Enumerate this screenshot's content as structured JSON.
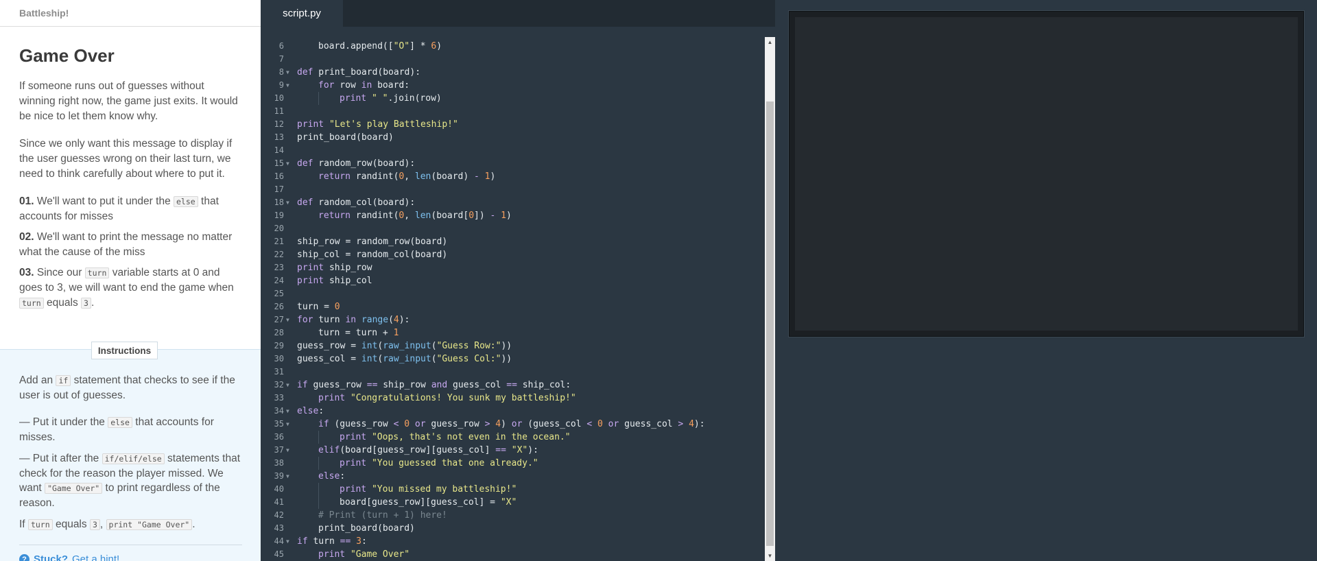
{
  "course": {
    "title": "Battleship!"
  },
  "lesson": {
    "title": "Game Over",
    "para1": "If someone runs out of guesses without winning right now, the game just exits. It would be nice to let them know why.",
    "para2": "Since we only want this message to display if the user guesses wrong on their last turn, we need to think carefully about where to put it.",
    "steps": [
      {
        "num": "01.",
        "pre": "We'll want to put it under the",
        "code": "else",
        "post": "that accounts for misses"
      },
      {
        "num": "02.",
        "text": "We'll want to print the message no matter what the cause of the miss"
      },
      {
        "num": "03.",
        "pre": "Since our",
        "code": "turn",
        "mid": "variable starts at 0 and goes to 3, we will want to end the game when",
        "code2": "turn",
        "mid2": "equals",
        "code3": "3",
        "post": "."
      }
    ]
  },
  "instructions": {
    "tab_label": "Instructions",
    "p1_pre": "Add an",
    "p1_code": "if",
    "p1_post": "statement that checks to see if the user is out of guesses.",
    "p2_pre": "— Put it under the",
    "p2_code": "else",
    "p2_post": "that accounts for misses.",
    "p3_pre": "— Put it after the",
    "p3_code": "if/elif/else",
    "p3_mid": "statements that check for the reason the player missed. We want",
    "p3_code2": "\"Game Over\"",
    "p3_post": "to print regardless of the reason.",
    "p4_pre": "If",
    "p4_code": "turn",
    "p4_mid": "equals",
    "p4_code2": "3",
    "p4_sep": ",",
    "p4_code3": "print \"Game Over\"",
    "p4_post": ".",
    "hint_stuck": "Stuck?",
    "hint_link": "Get a hint!"
  },
  "editor": {
    "tab": "script.py",
    "lines": [
      {
        "n": "6",
        "indent": 1,
        "fold": false,
        "tokens": [
          [
            "board.append([",
            ""
          ],
          [
            "\"O\"",
            "st"
          ],
          [
            "] * ",
            ""
          ],
          [
            "6",
            "nm"
          ],
          [
            ")",
            ""
          ]
        ]
      },
      {
        "n": "7",
        "indent": 0,
        "fold": false,
        "tokens": []
      },
      {
        "n": "8",
        "indent": 0,
        "fold": true,
        "tokens": [
          [
            "def",
            "kw"
          ],
          [
            " print_board(board):",
            ""
          ]
        ]
      },
      {
        "n": "9",
        "indent": 1,
        "fold": true,
        "tokens": [
          [
            "for",
            "kw"
          ],
          [
            " row ",
            ""
          ],
          [
            "in",
            "kw"
          ],
          [
            " board:",
            ""
          ]
        ]
      },
      {
        "n": "10",
        "indent": 2,
        "fold": false,
        "tokens": [
          [
            "print",
            "kw"
          ],
          [
            " ",
            ""
          ],
          [
            "\" \"",
            "st"
          ],
          [
            ".join(row)",
            ""
          ]
        ]
      },
      {
        "n": "11",
        "indent": 0,
        "fold": false,
        "tokens": []
      },
      {
        "n": "12",
        "indent": 0,
        "fold": false,
        "tokens": [
          [
            "print",
            "kw"
          ],
          [
            " ",
            ""
          ],
          [
            "\"Let's play Battleship!\"",
            "st"
          ]
        ]
      },
      {
        "n": "13",
        "indent": 0,
        "fold": false,
        "tokens": [
          [
            "print_board(board)",
            ""
          ]
        ]
      },
      {
        "n": "14",
        "indent": 0,
        "fold": false,
        "tokens": []
      },
      {
        "n": "15",
        "indent": 0,
        "fold": true,
        "tokens": [
          [
            "def",
            "kw"
          ],
          [
            " random_row(board):",
            ""
          ]
        ]
      },
      {
        "n": "16",
        "indent": 1,
        "fold": false,
        "tokens": [
          [
            "return",
            "kw"
          ],
          [
            " randint(",
            ""
          ],
          [
            "0",
            "nm"
          ],
          [
            ", ",
            ""
          ],
          [
            "len",
            "bi"
          ],
          [
            "(board) ",
            ""
          ],
          [
            "-",
            "kw"
          ],
          [
            " ",
            ""
          ],
          [
            "1",
            "nm"
          ],
          [
            ")",
            ""
          ]
        ]
      },
      {
        "n": "17",
        "indent": 0,
        "fold": false,
        "tokens": []
      },
      {
        "n": "18",
        "indent": 0,
        "fold": true,
        "tokens": [
          [
            "def",
            "kw"
          ],
          [
            " random_col(board):",
            ""
          ]
        ]
      },
      {
        "n": "19",
        "indent": 1,
        "fold": false,
        "tokens": [
          [
            "return",
            "kw"
          ],
          [
            " randint(",
            ""
          ],
          [
            "0",
            "nm"
          ],
          [
            ", ",
            ""
          ],
          [
            "len",
            "bi"
          ],
          [
            "(board[",
            ""
          ],
          [
            "0",
            "nm"
          ],
          [
            "]) ",
            ""
          ],
          [
            "-",
            "kw"
          ],
          [
            " ",
            ""
          ],
          [
            "1",
            "nm"
          ],
          [
            ")",
            ""
          ]
        ]
      },
      {
        "n": "20",
        "indent": 0,
        "fold": false,
        "tokens": []
      },
      {
        "n": "21",
        "indent": 0,
        "fold": false,
        "tokens": [
          [
            "ship_row = random_row(board)",
            ""
          ]
        ]
      },
      {
        "n": "22",
        "indent": 0,
        "fold": false,
        "tokens": [
          [
            "ship_col = random_col(board)",
            ""
          ]
        ]
      },
      {
        "n": "23",
        "indent": 0,
        "fold": false,
        "tokens": [
          [
            "print",
            "kw"
          ],
          [
            " ship_row",
            ""
          ]
        ]
      },
      {
        "n": "24",
        "indent": 0,
        "fold": false,
        "tokens": [
          [
            "print",
            "kw"
          ],
          [
            " ship_col",
            ""
          ]
        ]
      },
      {
        "n": "25",
        "indent": 0,
        "fold": false,
        "tokens": []
      },
      {
        "n": "26",
        "indent": 0,
        "fold": false,
        "tokens": [
          [
            "turn = ",
            ""
          ],
          [
            "0",
            "nm"
          ]
        ]
      },
      {
        "n": "27",
        "indent": 0,
        "fold": true,
        "tokens": [
          [
            "for",
            "kw"
          ],
          [
            " turn ",
            ""
          ],
          [
            "in",
            "kw"
          ],
          [
            " ",
            ""
          ],
          [
            "range",
            "bi"
          ],
          [
            "(",
            ""
          ],
          [
            "4",
            "nm"
          ],
          [
            "):",
            ""
          ]
        ]
      },
      {
        "n": "28",
        "indent": 1,
        "fold": false,
        "tokens": [
          [
            "turn = turn + ",
            ""
          ],
          [
            "1",
            "nm"
          ]
        ]
      },
      {
        "n": "29",
        "indent": 0,
        "fold": false,
        "tokens": [
          [
            "guess_row = ",
            ""
          ],
          [
            "int",
            "bi"
          ],
          [
            "(",
            ""
          ],
          [
            "raw_input",
            "bi"
          ],
          [
            "(",
            ""
          ],
          [
            "\"Guess Row:\"",
            "st"
          ],
          [
            "))",
            ""
          ]
        ]
      },
      {
        "n": "30",
        "indent": 0,
        "fold": false,
        "tokens": [
          [
            "guess_col = ",
            ""
          ],
          [
            "int",
            "bi"
          ],
          [
            "(",
            ""
          ],
          [
            "raw_input",
            "bi"
          ],
          [
            "(",
            ""
          ],
          [
            "\"Guess Col:\"",
            "st"
          ],
          [
            "))",
            ""
          ]
        ]
      },
      {
        "n": "31",
        "indent": 0,
        "fold": false,
        "tokens": []
      },
      {
        "n": "32",
        "indent": 0,
        "fold": true,
        "tokens": [
          [
            "if",
            "kw"
          ],
          [
            " guess_row ",
            ""
          ],
          [
            "==",
            "kw"
          ],
          [
            " ship_row ",
            ""
          ],
          [
            "and",
            "kw"
          ],
          [
            " guess_col ",
            ""
          ],
          [
            "==",
            "kw"
          ],
          [
            " ship_col:",
            ""
          ]
        ]
      },
      {
        "n": "33",
        "indent": 1,
        "fold": false,
        "tokens": [
          [
            "print",
            "kw"
          ],
          [
            " ",
            ""
          ],
          [
            "\"Congratulations! You sunk my battleship!\"",
            "st"
          ]
        ]
      },
      {
        "n": "34",
        "indent": 0,
        "fold": true,
        "tokens": [
          [
            "else",
            "kw"
          ],
          [
            ":",
            ""
          ]
        ]
      },
      {
        "n": "35",
        "indent": 1,
        "fold": true,
        "tokens": [
          [
            "if",
            "kw"
          ],
          [
            " (guess_row ",
            ""
          ],
          [
            "<",
            "kw"
          ],
          [
            " ",
            ""
          ],
          [
            "0",
            "nm"
          ],
          [
            " ",
            ""
          ],
          [
            "or",
            "kw"
          ],
          [
            " guess_row ",
            ""
          ],
          [
            ">",
            "kw"
          ],
          [
            " ",
            ""
          ],
          [
            "4",
            "nm"
          ],
          [
            ") ",
            ""
          ],
          [
            "or",
            "kw"
          ],
          [
            " (guess_col ",
            ""
          ],
          [
            "<",
            "kw"
          ],
          [
            " ",
            ""
          ],
          [
            "0",
            "nm"
          ],
          [
            " ",
            ""
          ],
          [
            "or",
            "kw"
          ],
          [
            " guess_col ",
            ""
          ],
          [
            ">",
            "kw"
          ],
          [
            " ",
            ""
          ],
          [
            "4",
            "nm"
          ],
          [
            "):",
            ""
          ]
        ]
      },
      {
        "n": "36",
        "indent": 2,
        "fold": false,
        "tokens": [
          [
            "print",
            "kw"
          ],
          [
            " ",
            ""
          ],
          [
            "\"Oops, that's not even in the ocean.\"",
            "st"
          ]
        ]
      },
      {
        "n": "37",
        "indent": 1,
        "fold": true,
        "tokens": [
          [
            "elif",
            "kw"
          ],
          [
            "(board[guess_row][guess_col] ",
            ""
          ],
          [
            "==",
            "kw"
          ],
          [
            " ",
            ""
          ],
          [
            "\"X\"",
            "st"
          ],
          [
            "):",
            ""
          ]
        ]
      },
      {
        "n": "38",
        "indent": 2,
        "fold": false,
        "tokens": [
          [
            "print",
            "kw"
          ],
          [
            " ",
            ""
          ],
          [
            "\"You guessed that one already.\"",
            "st"
          ]
        ]
      },
      {
        "n": "39",
        "indent": 1,
        "fold": true,
        "tokens": [
          [
            "else",
            "kw"
          ],
          [
            ":",
            ""
          ]
        ]
      },
      {
        "n": "40",
        "indent": 2,
        "fold": false,
        "tokens": [
          [
            "print",
            "kw"
          ],
          [
            " ",
            ""
          ],
          [
            "\"You missed my battleship!\"",
            "st"
          ]
        ]
      },
      {
        "n": "41",
        "indent": 2,
        "fold": false,
        "tokens": [
          [
            "board[guess_row][guess_col] = ",
            ""
          ],
          [
            "\"X\"",
            "st"
          ]
        ]
      },
      {
        "n": "42",
        "indent": 1,
        "fold": false,
        "tokens": [
          [
            "# Print (turn + 1) here!",
            "cm"
          ]
        ]
      },
      {
        "n": "43",
        "indent": 1,
        "fold": false,
        "tokens": [
          [
            "print_board(board)",
            ""
          ]
        ]
      },
      {
        "n": "44",
        "indent": 0,
        "fold": true,
        "tokens": [
          [
            "if",
            "kw"
          ],
          [
            " turn ",
            ""
          ],
          [
            "==",
            "kw"
          ],
          [
            " ",
            ""
          ],
          [
            "3",
            "nm"
          ],
          [
            ":",
            ""
          ]
        ]
      },
      {
        "n": "45",
        "indent": 1,
        "fold": false,
        "tokens": [
          [
            "print",
            "kw"
          ],
          [
            " ",
            ""
          ],
          [
            "\"Game Over\"",
            "st"
          ]
        ]
      }
    ]
  },
  "icons": {
    "fold": "chevron-down-icon",
    "scroll_up": "arrow-up-icon",
    "scroll_down": "arrow-down-icon",
    "hint": "question-icon"
  }
}
